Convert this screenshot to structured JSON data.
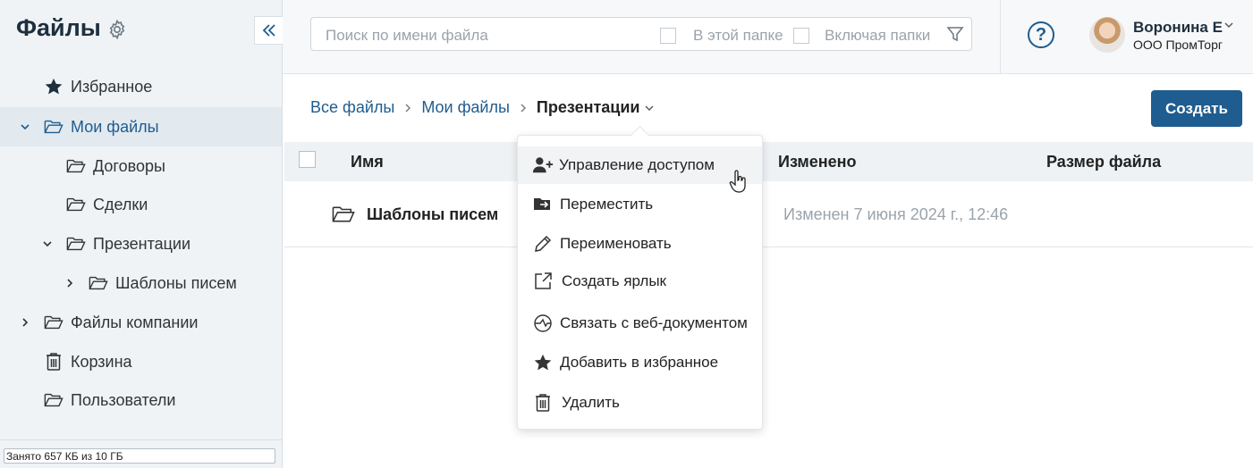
{
  "sidebar": {
    "title": "Файлы",
    "items": [
      {
        "label": "Избранное",
        "icon": "star-icon"
      },
      {
        "label": "Мои файлы",
        "icon": "folder-icon",
        "expanded": true,
        "active": true
      },
      {
        "label": "Договоры",
        "icon": "folder-icon"
      },
      {
        "label": "Сделки",
        "icon": "folder-icon"
      },
      {
        "label": "Презентации",
        "icon": "folder-icon",
        "expanded": true
      },
      {
        "label": "Шаблоны писем",
        "icon": "folder-icon",
        "expanded": false
      },
      {
        "label": "Файлы компании",
        "icon": "folder-icon",
        "expanded": false
      },
      {
        "label": "Корзина",
        "icon": "trash-icon"
      },
      {
        "label": "Пользователи",
        "icon": "folder-icon"
      }
    ],
    "storage": "Занято 657 КБ из 10 ГБ"
  },
  "search": {
    "placeholder": "Поиск по имени файла",
    "in_folder_label": "В этой папке",
    "include_folders_label": "Включая папки"
  },
  "user": {
    "name": "Воронина Е",
    "org": "ООО ПромТорг"
  },
  "breadcrumbs": {
    "items": [
      "Все файлы",
      "Мои файлы"
    ],
    "current": "Презентации"
  },
  "create_label": "Создать",
  "table": {
    "columns": {
      "name": "Имя",
      "modified": "Изменено",
      "size": "Размер файла"
    },
    "rows": [
      {
        "name": "Шаблоны писем",
        "modified": "Изменен 7 июня 2024 г., 12:46",
        "size": ""
      }
    ]
  },
  "context_menu": {
    "items": [
      {
        "label": "Управление доступом",
        "icon": "user-plus-icon"
      },
      {
        "label": "Переместить",
        "icon": "move-folder-icon"
      },
      {
        "label": "Переименовать",
        "icon": "pencil-icon"
      },
      {
        "label": "Создать ярлык",
        "icon": "shortcut-icon"
      },
      {
        "label": "Связать с веб-документом",
        "icon": "web-link-icon"
      },
      {
        "label": "Добавить в избранное",
        "icon": "star-icon"
      },
      {
        "label": "Удалить",
        "icon": "trash-icon"
      }
    ]
  },
  "colors": {
    "accent": "#1f5c8f",
    "sidebar_bg": "#eff3f6"
  }
}
